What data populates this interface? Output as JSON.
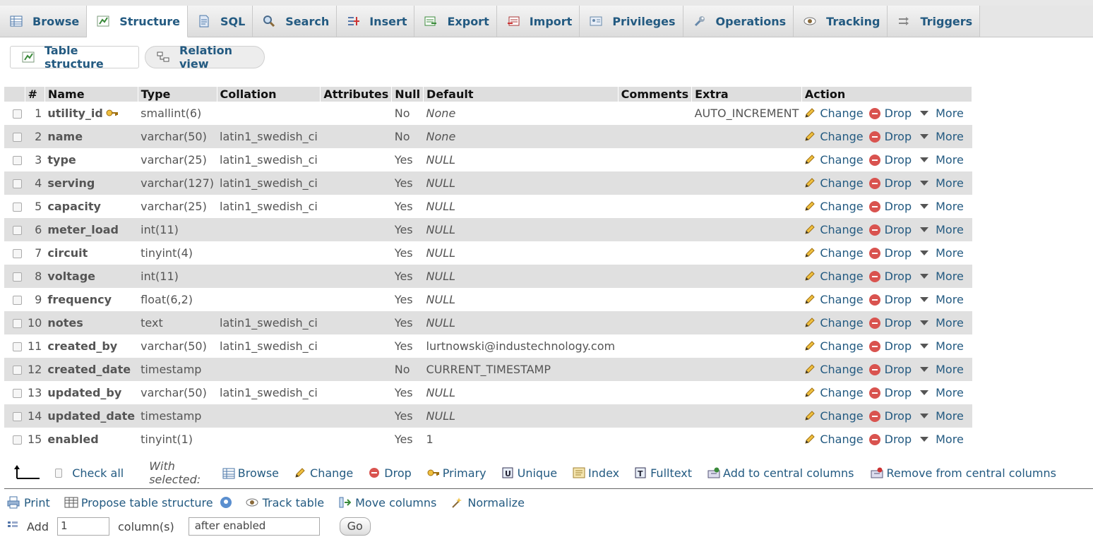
{
  "tabs": [
    {
      "label": "Browse",
      "icon": "browse-icon",
      "active": false
    },
    {
      "label": "Structure",
      "icon": "structure-icon",
      "active": true
    },
    {
      "label": "SQL",
      "icon": "sql-icon",
      "active": false
    },
    {
      "label": "Search",
      "icon": "search-icon",
      "active": false
    },
    {
      "label": "Insert",
      "icon": "insert-icon",
      "active": false
    },
    {
      "label": "Export",
      "icon": "export-icon",
      "active": false
    },
    {
      "label": "Import",
      "icon": "import-icon",
      "active": false
    },
    {
      "label": "Privileges",
      "icon": "privileges-icon",
      "active": false
    },
    {
      "label": "Operations",
      "icon": "wrench-icon",
      "active": false
    },
    {
      "label": "Tracking",
      "icon": "eye-icon",
      "active": false
    },
    {
      "label": "Triggers",
      "icon": "triggers-icon",
      "active": false
    }
  ],
  "subtabs": {
    "table_structure": "Table structure",
    "relation_view": "Relation view"
  },
  "table": {
    "headers": {
      "num": "#",
      "name": "Name",
      "type": "Type",
      "collation": "Collation",
      "attributes": "Attributes",
      "null": "Null",
      "default": "Default",
      "comments": "Comments",
      "extra": "Extra",
      "action": "Action"
    },
    "actions": {
      "change": "Change",
      "drop": "Drop",
      "more": "More"
    },
    "rows": [
      {
        "num": "1",
        "name": "utility_id",
        "type": "smallint(6)",
        "collation": "",
        "null": "No",
        "default": "None",
        "default_italic": true,
        "extra": "AUTO_INCREMENT",
        "primary_key": true
      },
      {
        "num": "2",
        "name": "name",
        "type": "varchar(50)",
        "collation": "latin1_swedish_ci",
        "null": "No",
        "default": "None",
        "default_italic": true,
        "extra": ""
      },
      {
        "num": "3",
        "name": "type",
        "type": "varchar(25)",
        "collation": "latin1_swedish_ci",
        "null": "Yes",
        "default": "NULL",
        "default_italic": true,
        "extra": ""
      },
      {
        "num": "4",
        "name": "serving",
        "type": "varchar(127)",
        "collation": "latin1_swedish_ci",
        "null": "Yes",
        "default": "NULL",
        "default_italic": true,
        "extra": ""
      },
      {
        "num": "5",
        "name": "capacity",
        "type": "varchar(25)",
        "collation": "latin1_swedish_ci",
        "null": "Yes",
        "default": "NULL",
        "default_italic": true,
        "extra": ""
      },
      {
        "num": "6",
        "name": "meter_load",
        "type": "int(11)",
        "collation": "",
        "null": "Yes",
        "default": "NULL",
        "default_italic": true,
        "extra": ""
      },
      {
        "num": "7",
        "name": "circuit",
        "type": "tinyint(4)",
        "collation": "",
        "null": "Yes",
        "default": "NULL",
        "default_italic": true,
        "extra": ""
      },
      {
        "num": "8",
        "name": "voltage",
        "type": "int(11)",
        "collation": "",
        "null": "Yes",
        "default": "NULL",
        "default_italic": true,
        "extra": ""
      },
      {
        "num": "9",
        "name": "frequency",
        "type": "float(6,2)",
        "collation": "",
        "null": "Yes",
        "default": "NULL",
        "default_italic": true,
        "extra": ""
      },
      {
        "num": "10",
        "name": "notes",
        "type": "text",
        "collation": "latin1_swedish_ci",
        "null": "Yes",
        "default": "NULL",
        "default_italic": true,
        "extra": ""
      },
      {
        "num": "11",
        "name": "created_by",
        "type": "varchar(50)",
        "collation": "latin1_swedish_ci",
        "null": "Yes",
        "default": "lurtnowski@industechnology.com",
        "default_italic": false,
        "extra": ""
      },
      {
        "num": "12",
        "name": "created_date",
        "type": "timestamp",
        "collation": "",
        "null": "No",
        "default": "CURRENT_TIMESTAMP",
        "default_italic": false,
        "extra": ""
      },
      {
        "num": "13",
        "name": "updated_by",
        "type": "varchar(50)",
        "collation": "latin1_swedish_ci",
        "null": "Yes",
        "default": "NULL",
        "default_italic": true,
        "extra": ""
      },
      {
        "num": "14",
        "name": "updated_date",
        "type": "timestamp",
        "collation": "",
        "null": "Yes",
        "default": "NULL",
        "default_italic": true,
        "extra": ""
      },
      {
        "num": "15",
        "name": "enabled",
        "type": "tinyint(1)",
        "collation": "",
        "null": "Yes",
        "default": "1",
        "default_italic": false,
        "extra": ""
      }
    ]
  },
  "with_selected": {
    "check_all": "Check all",
    "label": "With selected:",
    "items": [
      {
        "label": "Browse",
        "icon": "browse-icon"
      },
      {
        "label": "Change",
        "icon": "pencil-icon"
      },
      {
        "label": "Drop",
        "icon": "drop-icon"
      },
      {
        "label": "Primary",
        "icon": "key-icon"
      },
      {
        "label": "Unique",
        "icon": "unique-icon"
      },
      {
        "label": "Index",
        "icon": "index-icon"
      },
      {
        "label": "Fulltext",
        "icon": "fulltext-icon"
      },
      {
        "label": "Add to central columns",
        "icon": "add-central-icon"
      },
      {
        "label": "Remove from central columns",
        "icon": "remove-central-icon"
      }
    ]
  },
  "tools": [
    {
      "label": "Print",
      "icon": "print-icon"
    },
    {
      "label": "Propose table structure",
      "icon": "propose-icon"
    },
    {
      "label": "Track table",
      "icon": "eye-icon"
    },
    {
      "label": "Move columns",
      "icon": "move-columns-icon"
    },
    {
      "label": "Normalize",
      "icon": "normalize-icon"
    }
  ],
  "add_columns": {
    "prefix": "Add",
    "count": "1",
    "suffix": "column(s)",
    "position": "after enabled",
    "go": "Go"
  }
}
